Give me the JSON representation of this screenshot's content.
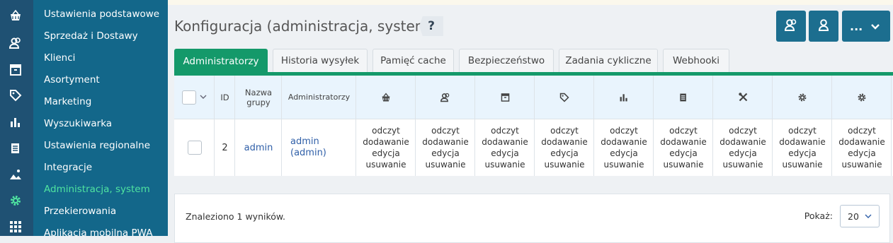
{
  "sidebar": {
    "icons": [
      "basket-icon",
      "users-icon",
      "archive-icon",
      "tag-icon",
      "bar-chart-icon",
      "documents-icon",
      "image-icon",
      "gear-icon",
      "grid-icon"
    ],
    "items": [
      {
        "label": "Ustawienia podstawowe"
      },
      {
        "label": "Sprzedaż i Dostawy"
      },
      {
        "label": "Klienci"
      },
      {
        "label": "Asortyment"
      },
      {
        "label": "Marketing"
      },
      {
        "label": "Wyszukiwarka"
      },
      {
        "label": "Ustawienia regionalne"
      },
      {
        "label": "Integracje"
      },
      {
        "label": "Administracja, system"
      },
      {
        "label": "Przekierowania"
      },
      {
        "label": "Aplikacja mobilna PWA"
      }
    ],
    "active_index": 8
  },
  "header": {
    "title": "Konfiguracja (administracja, system)",
    "help_label": "?",
    "more_label": "..."
  },
  "tabs": [
    {
      "label": "Administratorzy",
      "active": true
    },
    {
      "label": "Historia wysyłek",
      "active": false
    },
    {
      "label": "Pamięć cache",
      "active": false
    },
    {
      "label": "Bezpieczeństwo",
      "active": false
    },
    {
      "label": "Zadania cykliczne",
      "active": false
    },
    {
      "label": "Webhooki",
      "active": false
    }
  ],
  "table": {
    "headers": {
      "id": "ID",
      "group_name": "Nazwa grupy",
      "admins": "Administratorzy"
    },
    "perm_columns": [
      "basket-icon",
      "users-icon",
      "archive-icon",
      "tag-icon",
      "bar-chart-icon",
      "documents-icon",
      "tools-icon",
      "gear-icon",
      "gear-icon"
    ],
    "rows": [
      {
        "id": "2",
        "group": "admin",
        "admins": "admin (admin)",
        "perm": {
          "read": "odczyt",
          "add": "dodawanie",
          "edit": "edycja",
          "delete": "usuwanie"
        }
      }
    ]
  },
  "footer": {
    "found": "Znaleziono 1 wyników.",
    "show_label": "Pokaż:",
    "per_page": "20"
  },
  "colors": {
    "sidebar_dark": "#1f5173",
    "sidebar": "#13678a",
    "accent": "#14996a",
    "active_menu": "#4fe3a0",
    "button": "#1c6e8f"
  }
}
